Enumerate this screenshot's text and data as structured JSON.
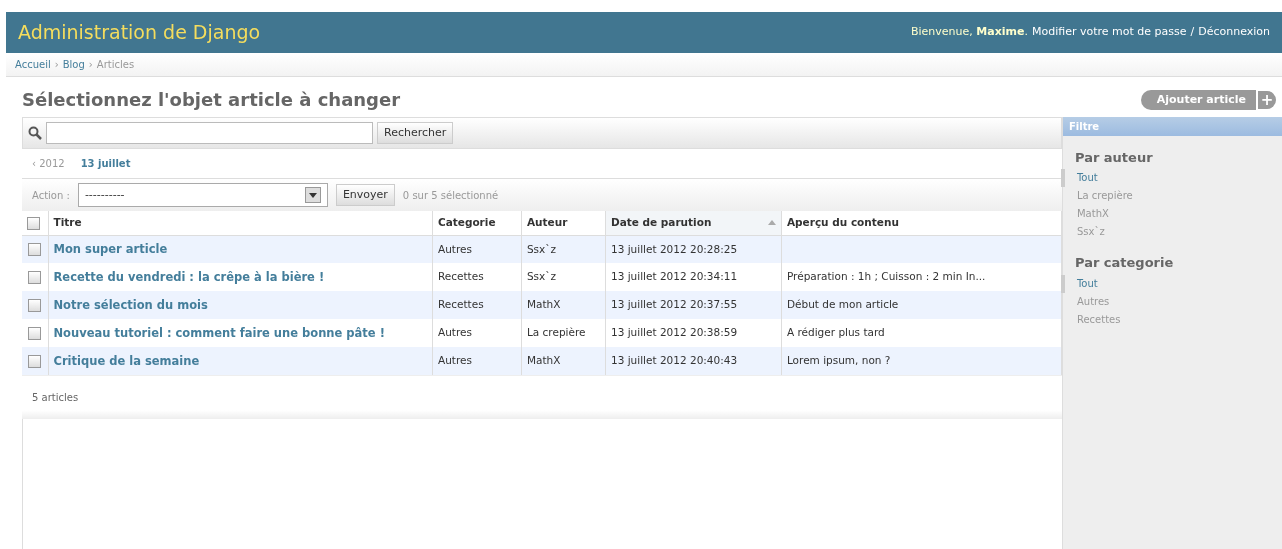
{
  "header": {
    "title": "Administration de Django",
    "greeting": "Bienvenue, **Maxime**.",
    "links": [
      "Modifier votre mot de passe",
      "Déconnexion"
    ],
    "link_separator": "/"
  },
  "breadcrumbs": {
    "separator": "›",
    "items": [
      {
        "label": "Accueil",
        "link": true
      },
      {
        "label": "Blog",
        "link": true
      },
      {
        "label": "Articles",
        "link": false
      }
    ]
  },
  "page_title": "Sélectionnez l'objet article à changer",
  "add_button": {
    "label": "Ajouter article",
    "icon": "+"
  },
  "search": {
    "button": "Rechercher"
  },
  "date_hierarchy": {
    "back": "‹ 2012",
    "current": "13 juillet"
  },
  "actions": {
    "label": "Action :",
    "value": "----------",
    "button": "Envoyer",
    "counter": "0 sur 5 sélectionné"
  },
  "table": {
    "select_all_checked": false,
    "columns": [
      {
        "label": "Titre",
        "sorted": false
      },
      {
        "label": "Categorie",
        "sorted": false
      },
      {
        "label": "Auteur",
        "sorted": false
      },
      {
        "label": "Date de parution",
        "sorted": true
      },
      {
        "label": "Aperçu du contenu",
        "sorted": false
      }
    ],
    "rows": [
      {
        "checked": false,
        "cells": [
          "Mon super article",
          "Autres",
          "Ssx`z",
          "13 juillet 2012 20:28:25",
          ""
        ]
      },
      {
        "checked": false,
        "cells": [
          "Recette du vendredi : la crêpe à la bière !",
          "Recettes",
          "Ssx`z",
          "13 juillet 2012 20:34:11",
          "Préparation : 1h ; Cuisson : 2 min In..."
        ]
      },
      {
        "checked": false,
        "cells": [
          "Notre sélection du mois",
          "Recettes",
          "MathX",
          "13 juillet 2012 20:37:55",
          "Début de mon article"
        ]
      },
      {
        "checked": false,
        "cells": [
          "Nouveau tutoriel : comment faire une bonne pâte !",
          "Autres",
          "La crepière",
          "13 juillet 2012 20:38:59",
          "A rédiger plus tard"
        ]
      },
      {
        "checked": false,
        "cells": [
          "Critique de la semaine",
          "Autres",
          "MathX",
          "13 juillet 2012 20:40:43",
          "Lorem ipsum, non ?"
        ]
      }
    ],
    "footer": "5 articles"
  },
  "filter": {
    "title": "Filtre",
    "groups": [
      {
        "title": "Par auteur",
        "items": [
          {
            "label": "Tout",
            "selected": true
          },
          {
            "label": "La crepière",
            "selected": false
          },
          {
            "label": "MathX",
            "selected": false
          },
          {
            "label": "Ssx`z",
            "selected": false
          }
        ]
      },
      {
        "title": "Par categorie",
        "items": [
          {
            "label": "Tout",
            "selected": true
          },
          {
            "label": "Autres",
            "selected": false
          },
          {
            "label": "Recettes",
            "selected": false
          }
        ]
      }
    ]
  }
}
